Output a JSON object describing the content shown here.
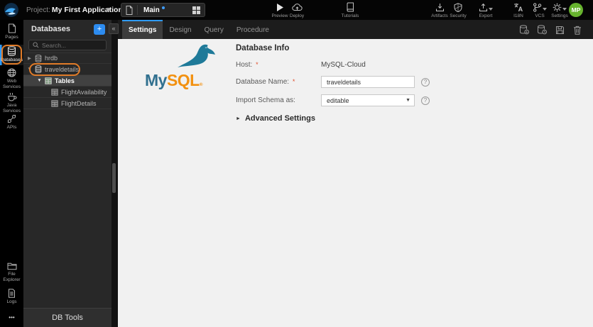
{
  "topbar": {
    "project_label": "Project:",
    "project_name": "My First Application",
    "breadcrumb_chevron": "›",
    "page_tab": {
      "name": "Main"
    },
    "actions": {
      "preview": "Preview",
      "deploy": "Deploy",
      "tutorials": "Tutorials",
      "artifacts": "Artifacts",
      "security": "Security",
      "export": "Export",
      "i18n": "I18N",
      "vcs": "VCS",
      "settings": "Settings"
    },
    "avatar_initials": "MP"
  },
  "sidebar": {
    "items": [
      {
        "label": "Pages"
      },
      {
        "label": "Databases",
        "active": true
      },
      {
        "label": "Web Services"
      },
      {
        "label": "Java Services"
      },
      {
        "label": "APIs"
      },
      {
        "label": "File Explorer"
      },
      {
        "label": "Logs"
      }
    ],
    "more_label": "•••"
  },
  "db_panel": {
    "title": "Databases",
    "add_button": "+",
    "collapse_button": "«",
    "search_placeholder": "Search...",
    "collapsed_arrow": "▶",
    "expanded_arrow": "▼",
    "tree": [
      {
        "label": "hrdb",
        "type": "database",
        "state": "collapsed"
      },
      {
        "label": "traveldetails",
        "type": "database",
        "state": "expanded",
        "highlighted": true
      },
      {
        "label": "Tables",
        "type": "folder",
        "state": "expanded",
        "selected": true
      },
      {
        "label": "FlightAvailability",
        "type": "table"
      },
      {
        "label": "FlightDetails",
        "type": "table"
      }
    ],
    "footer": "DB Tools"
  },
  "main": {
    "tabs": [
      {
        "label": "Settings",
        "active": true
      },
      {
        "label": "Design"
      },
      {
        "label": "Query"
      },
      {
        "label": "Procedure"
      }
    ],
    "logo": {
      "brand_prefix": "My",
      "brand_suffix": "SQL",
      "registered_mark": "®"
    },
    "form": {
      "title": "Database Info",
      "required_marker": "*",
      "host": {
        "label": "Host:",
        "value": "MySQL-Cloud"
      },
      "dbname": {
        "label": "Database Name:",
        "value": "traveldetails"
      },
      "import_schema": {
        "label": "Import Schema as:",
        "value": "editable",
        "dropdown_arrow": "▼"
      },
      "advanced": {
        "arrow": "►",
        "label": "Advanced Settings"
      },
      "help_glyph": "?"
    }
  },
  "colors": {
    "accent_blue": "#2d8cf0",
    "active_tab_border": "#2f9bff",
    "annotation_orange": "#e07b28",
    "avatar_green": "#67b32e",
    "mysql_blue": "#31708f",
    "mysql_orange": "#f29111",
    "required_red": "#e04f2c"
  }
}
